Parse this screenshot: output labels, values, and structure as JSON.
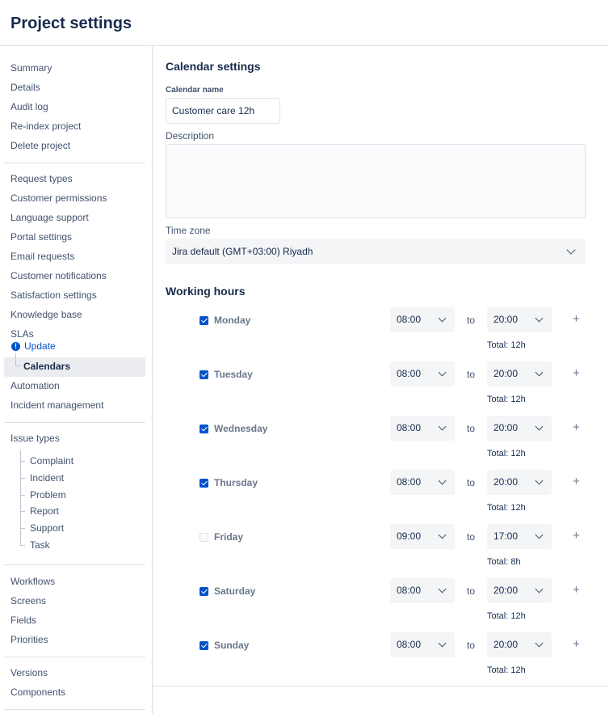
{
  "header": {
    "title": "Project settings"
  },
  "sidebar": {
    "group1": [
      "Summary",
      "Details",
      "Audit log",
      "Re-index project",
      "Delete project"
    ],
    "group2": [
      "Request types",
      "Customer permissions",
      "Language support",
      "Portal settings",
      "Email requests",
      "Customer notifications",
      "Satisfaction settings",
      "Knowledge base",
      "SLAs"
    ],
    "sla_update": "Update",
    "sla_calendars": "Calendars",
    "group2b": [
      "Automation",
      "Incident management"
    ],
    "issue_types": {
      "label": "Issue types",
      "items": [
        "Complaint",
        "Incident",
        "Problem",
        "Report",
        "Support",
        "Task"
      ]
    },
    "group4": [
      "Workflows",
      "Screens",
      "Fields",
      "Priorities"
    ],
    "group5": [
      "Versions",
      "Components"
    ]
  },
  "calendar": {
    "section_title": "Calendar settings",
    "name_label": "Calendar name",
    "name_value": "Customer care 12h",
    "description_label": "Description",
    "description_value": "",
    "timezone_label": "Time zone",
    "timezone_value": "Jira default (GMT+03:00) Riyadh"
  },
  "working_hours": {
    "title": "Working hours",
    "to_label": "to",
    "days": [
      {
        "day": "Monday",
        "checked": true,
        "from": "08:00",
        "to": "20:00",
        "total": "Total: 12h"
      },
      {
        "day": "Tuesday",
        "checked": true,
        "from": "08:00",
        "to": "20:00",
        "total": "Total: 12h"
      },
      {
        "day": "Wednesday",
        "checked": true,
        "from": "08:00",
        "to": "20:00",
        "total": "Total: 12h"
      },
      {
        "day": "Thursday",
        "checked": true,
        "from": "08:00",
        "to": "20:00",
        "total": "Total: 12h"
      },
      {
        "day": "Friday",
        "checked": false,
        "from": "09:00",
        "to": "17:00",
        "total": "Total: 8h"
      },
      {
        "day": "Saturday",
        "checked": true,
        "from": "08:00",
        "to": "20:00",
        "total": "Total: 12h"
      },
      {
        "day": "Sunday",
        "checked": true,
        "from": "08:00",
        "to": "20:00",
        "total": "Total: 12h"
      }
    ]
  },
  "colors": {
    "accent": "#0052cc",
    "text": "#172b4d",
    "muted": "#42526e",
    "field_bg": "#f4f5f7"
  },
  "icons": {
    "update": "info-icon",
    "dropdown": "chevron-down-icon",
    "add": "plus-icon",
    "checkbox": "check-icon"
  }
}
